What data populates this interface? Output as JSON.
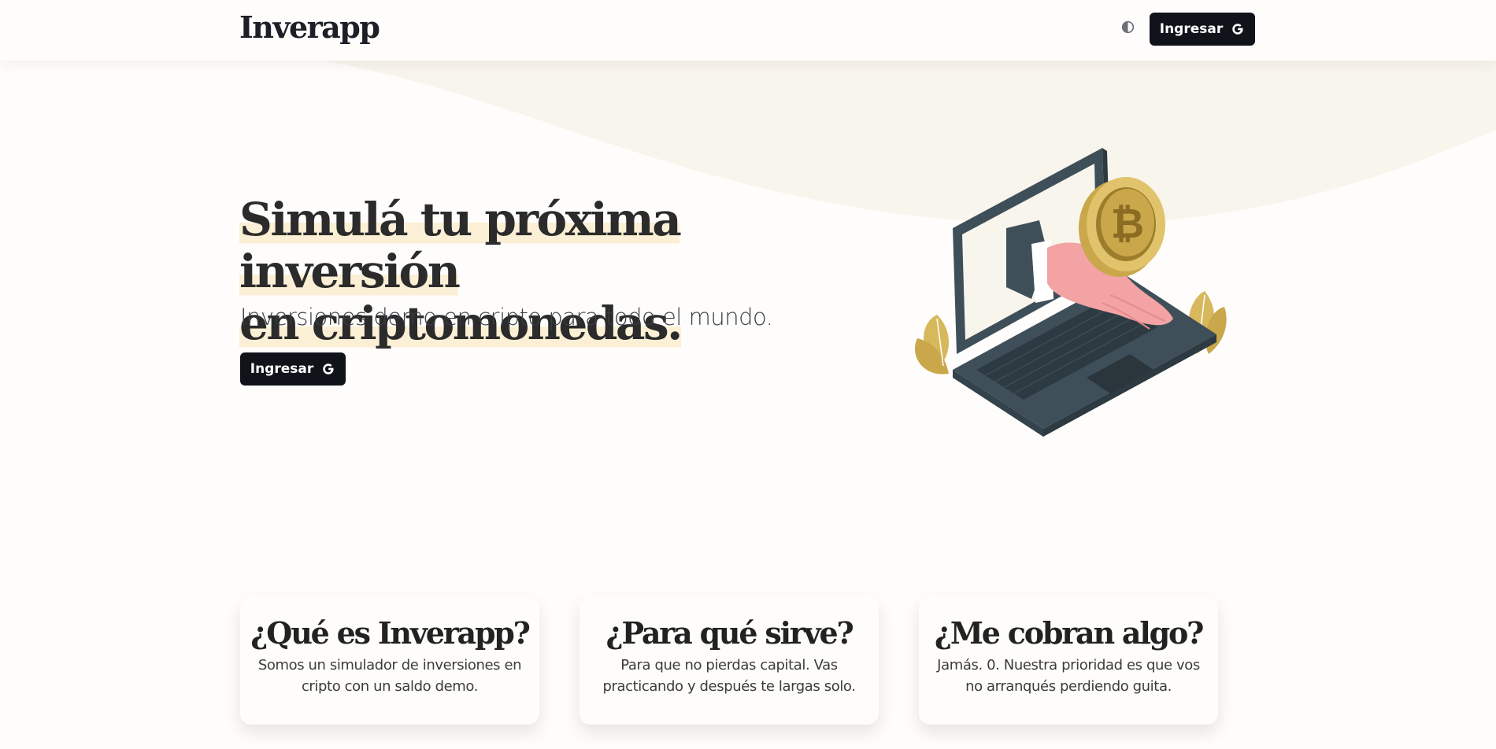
{
  "header": {
    "logo": "Inverapp",
    "theme_toggle_icon": "contrast-icon",
    "login_button_label": "Ingresar",
    "login_button_icon": "google-icon"
  },
  "hero": {
    "title_line1": "Simulá tu próxima inversión",
    "title_line2": "en criptomonedas.",
    "subtitle": "Inversiones demo en cripto para todo el mundo.",
    "cta_label": "Ingresar",
    "cta_icon": "google-icon",
    "illustration": "laptop-hand-bitcoin-illustration"
  },
  "cards": [
    {
      "title": "¿Qué es Inverapp?",
      "text": "Somos un simulador de inversiones en cripto con un saldo demo."
    },
    {
      "title": "¿Para qué sirve?",
      "text": "Para que no pierdas capital. Vas practicando y después te largas solo."
    },
    {
      "title": "¿Me cobran algo?",
      "text": "Jamás. 0. Nuestra prioridad es que vos no arranqués perdiendo guita."
    }
  ],
  "colors": {
    "background": "#fefdfb",
    "wave": "#f8f5ec",
    "button": "#10131a",
    "highlight": "#fbefd5",
    "gold": "#d8b85c",
    "laptop": "#3f4f5a",
    "hand": "#f3a3a3"
  }
}
